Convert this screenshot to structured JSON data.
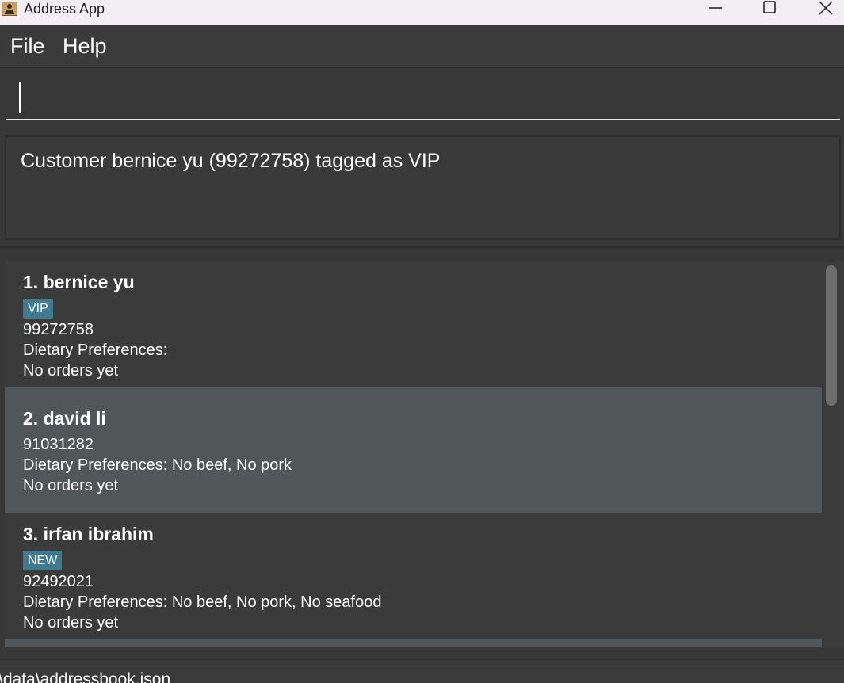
{
  "window": {
    "title": "Address App",
    "controls": [
      "minimize-icon",
      "maximize-icon",
      "close-icon"
    ]
  },
  "menu": {
    "file": "File",
    "help": "Help"
  },
  "command": {
    "value": ""
  },
  "result": {
    "message": "Customer bernice yu (99272758) tagged as VIP"
  },
  "customers": [
    {
      "name": "1. bernice yu",
      "tag": "VIP",
      "phone": "99272758",
      "dietary": "Dietary Preferences:",
      "orders": "No orders yet"
    },
    {
      "name": "2. david li",
      "tag": "",
      "phone": "91031282",
      "dietary": "Dietary Preferences: No beef, No pork",
      "orders": "No orders yet"
    },
    {
      "name": "3. irfan ibrahim",
      "tag": "NEW",
      "phone": "92492021",
      "dietary": "Dietary Preferences: No beef, No pork, No seafood",
      "orders": "No orders yet"
    }
  ],
  "status": {
    "path": "\\data\\addressbook.json"
  },
  "colors": {
    "tag_background": "#3e7b91",
    "selected_row": "#515658",
    "background": "#383838"
  }
}
